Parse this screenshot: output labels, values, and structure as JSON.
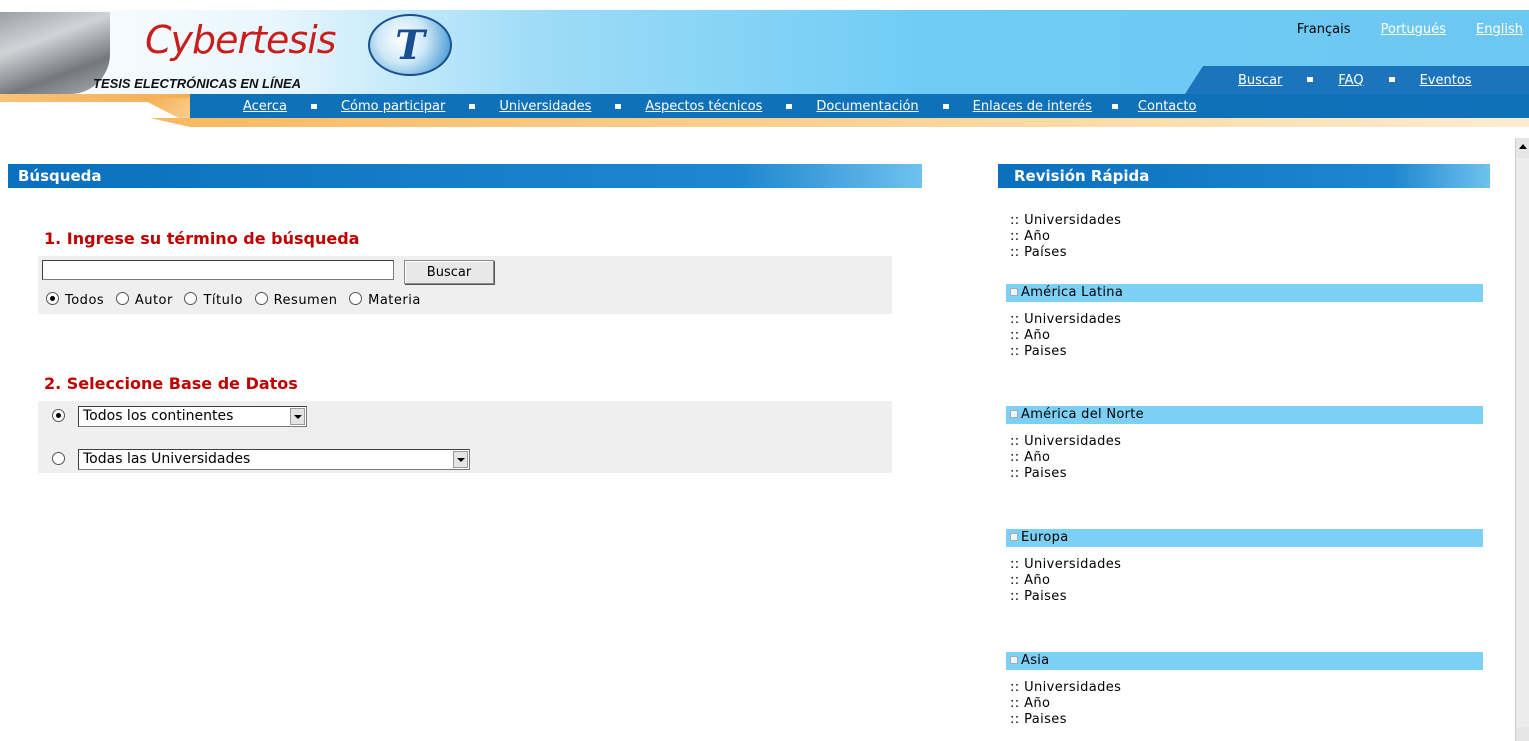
{
  "header": {
    "logo_text": "Cybertesis",
    "logo_letter": "T",
    "tagline": "TESIS ELECTRÓNICAS EN LÍNEA",
    "languages": [
      "Français",
      "Portugués",
      "English"
    ],
    "top_nav": [
      "Buscar",
      "FAQ",
      "Eventos"
    ],
    "main_nav": [
      "Acerca",
      "Cómo participar",
      "Universidades",
      "Aspectos técnicos",
      "Documentación",
      "Enlaces de interés",
      "Contacto"
    ]
  },
  "search": {
    "section_title": "Búsqueda",
    "step1_title": "1. Ingrese su término de búsqueda",
    "input_value": "",
    "button_label": "Buscar",
    "fields": [
      "Todos",
      "Autor",
      "Título",
      "Resumen",
      "Materia"
    ],
    "selected_field": "Todos",
    "step2_title": "2. Seleccione Base de Datos",
    "continent_select": "Todos los continentes",
    "university_select": "Todas las Universidades"
  },
  "quick_review": {
    "title": "Revisión Rápida",
    "general_links": [
      ":: Universidades",
      ":: Año",
      ":: Países"
    ],
    "regions": [
      {
        "name": "América Latina",
        "links": [
          ":: Universidades",
          ":: Año",
          ":: Paises"
        ]
      },
      {
        "name": "América del Norte",
        "links": [
          ":: Universidades",
          ":: Año",
          ":: Paises"
        ]
      },
      {
        "name": "Europa",
        "links": [
          ":: Universidades",
          ":: Año",
          ":: Paises"
        ]
      },
      {
        "name": "Asia",
        "links": [
          ":: Universidades",
          ":: Año",
          ":: Paises"
        ]
      }
    ]
  },
  "colors": {
    "section_bar": "#0a6fbd",
    "region_bar": "#7dd0f5",
    "step_title": "#c00000",
    "nav_bar": "#0f72b8"
  }
}
